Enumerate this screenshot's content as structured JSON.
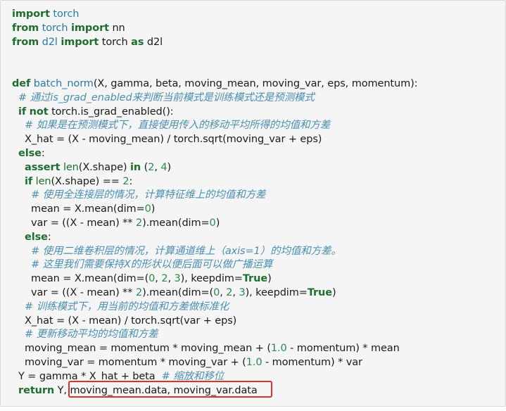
{
  "code_lines": [
    [
      {
        "t": "import",
        "c": "kw"
      },
      {
        "t": " "
      },
      {
        "t": "torch",
        "c": "mod"
      }
    ],
    [
      {
        "t": "from",
        "c": "kw"
      },
      {
        "t": " "
      },
      {
        "t": "torch",
        "c": "mod"
      },
      {
        "t": " "
      },
      {
        "t": "import",
        "c": "kw"
      },
      {
        "t": " nn"
      }
    ],
    [
      {
        "t": "from",
        "c": "kw"
      },
      {
        "t": " "
      },
      {
        "t": "d2l",
        "c": "mod"
      },
      {
        "t": " "
      },
      {
        "t": "import",
        "c": "kw"
      },
      {
        "t": " torch "
      },
      {
        "t": "as",
        "c": "kw"
      },
      {
        "t": " d2l"
      }
    ],
    [],
    [],
    [
      {
        "t": "def",
        "c": "kw"
      },
      {
        "t": " "
      },
      {
        "t": "batch_norm",
        "c": "fn"
      },
      {
        "t": "(X, gamma, beta, moving_mean, moving_var, eps, momentum):"
      }
    ],
    [
      {
        "t": "  "
      },
      {
        "t": "# 通过is_grad_enabled来判断当前模式是训练模式还是预测模式",
        "c": "cmt"
      }
    ],
    [
      {
        "t": "  "
      },
      {
        "t": "if",
        "c": "kw"
      },
      {
        "t": " "
      },
      {
        "t": "not",
        "c": "kw"
      },
      {
        "t": " torch.is_grad_enabled():"
      }
    ],
    [
      {
        "t": "    "
      },
      {
        "t": "# 如果是在预测模式下，直接使用传入的移动平均所得的均值和方差",
        "c": "cmt"
      }
    ],
    [
      {
        "t": "    X_hat = (X - moving_mean) / torch.sqrt(moving_var + eps)"
      }
    ],
    [
      {
        "t": "  "
      },
      {
        "t": "else",
        "c": "kw"
      },
      {
        "t": ":"
      }
    ],
    [
      {
        "t": "    "
      },
      {
        "t": "assert",
        "c": "kw"
      },
      {
        "t": " "
      },
      {
        "t": "len",
        "c": "builtin"
      },
      {
        "t": "(X.shape) "
      },
      {
        "t": "in",
        "c": "kw"
      },
      {
        "t": " ("
      },
      {
        "t": "2",
        "c": "num"
      },
      {
        "t": ", "
      },
      {
        "t": "4",
        "c": "num"
      },
      {
        "t": ")"
      }
    ],
    [
      {
        "t": "    "
      },
      {
        "t": "if",
        "c": "kw"
      },
      {
        "t": " "
      },
      {
        "t": "len",
        "c": "builtin"
      },
      {
        "t": "(X.shape) == "
      },
      {
        "t": "2",
        "c": "num"
      },
      {
        "t": ":"
      }
    ],
    [
      {
        "t": "      "
      },
      {
        "t": "# 使用全连接层的情况，计算特征维上的均值和方差",
        "c": "cmt"
      }
    ],
    [
      {
        "t": "      mean = X.mean(dim="
      },
      {
        "t": "0",
        "c": "num"
      },
      {
        "t": ")"
      }
    ],
    [
      {
        "t": "      var = ((X - mean) ** "
      },
      {
        "t": "2",
        "c": "num"
      },
      {
        "t": ").mean(dim="
      },
      {
        "t": "0",
        "c": "num"
      },
      {
        "t": ")"
      }
    ],
    [
      {
        "t": "    "
      },
      {
        "t": "else",
        "c": "kw"
      },
      {
        "t": ":"
      }
    ],
    [
      {
        "t": "      "
      },
      {
        "t": "# 使用二维卷积层的情况，计算通道维上（axis=1）的均值和方差。",
        "c": "cmt"
      }
    ],
    [
      {
        "t": "      "
      },
      {
        "t": "# 这里我们需要保持X的形状以便后面可以做广播运算",
        "c": "cmt"
      }
    ],
    [
      {
        "t": "      mean = X.mean(dim=("
      },
      {
        "t": "0",
        "c": "num"
      },
      {
        "t": ", "
      },
      {
        "t": "2",
        "c": "num"
      },
      {
        "t": ", "
      },
      {
        "t": "3",
        "c": "num"
      },
      {
        "t": "), keepdim="
      },
      {
        "t": "True",
        "c": "kw"
      },
      {
        "t": ")"
      }
    ],
    [
      {
        "t": "      var = ((X - mean) ** "
      },
      {
        "t": "2",
        "c": "num"
      },
      {
        "t": ").mean(dim=("
      },
      {
        "t": "0",
        "c": "num"
      },
      {
        "t": ", "
      },
      {
        "t": "2",
        "c": "num"
      },
      {
        "t": ", "
      },
      {
        "t": "3",
        "c": "num"
      },
      {
        "t": "), keepdim="
      },
      {
        "t": "True",
        "c": "kw"
      },
      {
        "t": ")"
      }
    ],
    [
      {
        "t": "    "
      },
      {
        "t": "# 训练模式下，用当前的均值和方差做标准化",
        "c": "cmt"
      }
    ],
    [
      {
        "t": "    X_hat = (X - mean) / torch.sqrt(var + eps)"
      }
    ],
    [
      {
        "t": "    "
      },
      {
        "t": "# 更新移动平均的均值和方差",
        "c": "cmt"
      }
    ],
    [
      {
        "t": "    moving_mean = momentum * moving_mean + ("
      },
      {
        "t": "1.0",
        "c": "num"
      },
      {
        "t": " - momentum) * mean"
      }
    ],
    [
      {
        "t": "    moving_var = momentum * moving_var + ("
      },
      {
        "t": "1.0",
        "c": "num"
      },
      {
        "t": " - momentum) * var"
      }
    ],
    [
      {
        "t": "  Y = gamma * X_hat + beta  "
      },
      {
        "t": "# 缩放和移位",
        "c": "cmt"
      }
    ],
    [
      {
        "t": "  "
      },
      {
        "t": "return",
        "c": "kw"
      },
      {
        "t": " Y, moving_mean.data, moving_var.data"
      }
    ]
  ],
  "colors": {
    "keyword": "#1f6e2f",
    "module": "#2a7aa8",
    "number": "#2a8a4a",
    "comment": "#4b8fb0",
    "highlight_border": "#e0302a",
    "background": "#f5f5f5"
  }
}
